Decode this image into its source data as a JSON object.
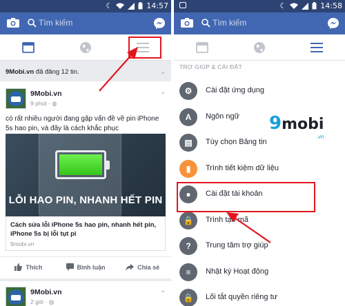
{
  "left": {
    "status": {
      "time": "14:57"
    },
    "search": {
      "placeholder": "Tìm kiếm"
    },
    "feed": {
      "page": "9Mobi.vn",
      "header_suffix": " đã đăng 12 tin."
    },
    "post": {
      "author": "9Mobi.vn",
      "time": "9 phút · ",
      "text": "có rất nhiều người đang gặp vấn đề về pin iPhone 5s hao pin, và đây là cách khắc phục",
      "image_caption": "LỖI HAO PIN, NHANH HẾT PIN",
      "link_title": "Cách sửa lỗi iPhone 5s hao pin, nhanh hết pin, iPhone 5s bị lỗi tụt pi",
      "link_domain": "9mobi.vn",
      "actions": {
        "like": "Thích",
        "comment": "Bình luận",
        "share": "Chia sẻ"
      }
    },
    "post2": {
      "author": "9Mobi.vn",
      "time": "2 giờ · "
    }
  },
  "right": {
    "status": {
      "time": "14:58"
    },
    "search": {
      "placeholder": "Tìm kiếm"
    },
    "section_label": "TRỢ GIÚP & CÀI ĐẶT",
    "menu": [
      {
        "label": "Cài đặt ứng dụng",
        "icon": "gear-icon",
        "color": "#606770"
      },
      {
        "label": "Ngôn ngữ",
        "icon": "language-icon",
        "color": "#606770"
      },
      {
        "label": "Tùy chọn Bảng tin",
        "icon": "news-feed-icon",
        "color": "#606770"
      },
      {
        "label": "Trình tiết kiệm dữ liệu",
        "icon": "data-saver-icon",
        "color": "#f7923a"
      },
      {
        "label": "Cài đặt tài khoản",
        "icon": "account-settings-icon",
        "color": "#606770"
      },
      {
        "label": "Trình tạo mã",
        "icon": "lock-icon",
        "color": "#606770"
      },
      {
        "label": "Trung tâm trợ giúp",
        "icon": "help-icon",
        "color": "#606770"
      },
      {
        "label": "Nhật ký Hoạt động",
        "icon": "activity-log-icon",
        "color": "#606770"
      },
      {
        "label": "Lối tắt quyền riêng tư",
        "icon": "privacy-lock-icon",
        "color": "#606770"
      }
    ],
    "watermark": {
      "nine": "9",
      "mobi": "mobi",
      "vn": ".vn"
    }
  },
  "colors": {
    "fb_blue": "#4267b2",
    "status_bar": "#2d4373",
    "highlight_red": "#e3141d"
  }
}
